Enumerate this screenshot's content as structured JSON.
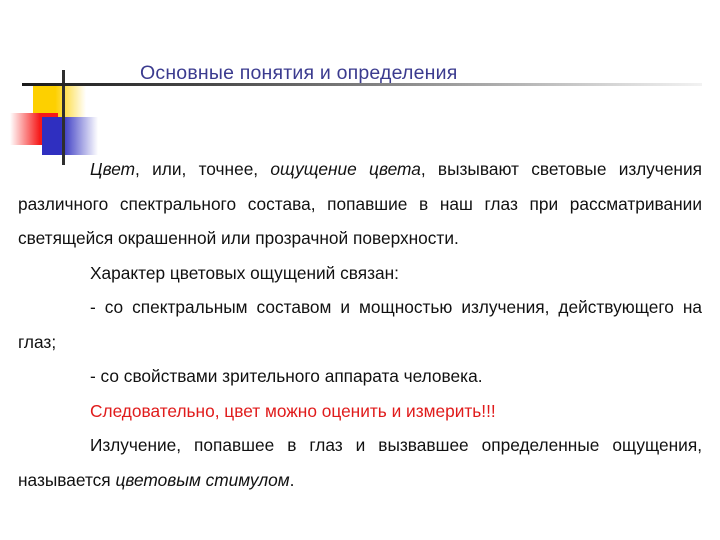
{
  "slide": {
    "title": "Основные понятия и определения",
    "title_color": "#3b3b8f",
    "background_color": "#ffffff",
    "accent_red": "#e01b1b",
    "logo": {
      "yellow_color": "#fdd000",
      "red_color": "#f61a1a",
      "blue_color": "#2f2fc0",
      "rule_color": "#1a1a1a"
    },
    "paragraphs": {
      "p1_a": "Цвет",
      "p1_b": ", или, точнее, ",
      "p1_c": "ощущение цвета",
      "p1_d": ", вызывают световые излучения различного спектрального состава, попавшие в наш глаз при рассматривании светящейся окрашенной или прозрачной поверхности.",
      "p2": "Характер цветовых ощущений связан:",
      "p3": "- со спектральным составом и мощностью излучения, действующего на глаз;",
      "p4": "- со свойствами зрительного аппарата человека.",
      "p5": "Следовательно, цвет можно оценить и измерить!!!",
      "p6_a": "Излучение, попавшее в глаз и вызвавшее определенные ощущения, называется ",
      "p6_b": "цветовым стимулом",
      "p6_c": "."
    }
  }
}
